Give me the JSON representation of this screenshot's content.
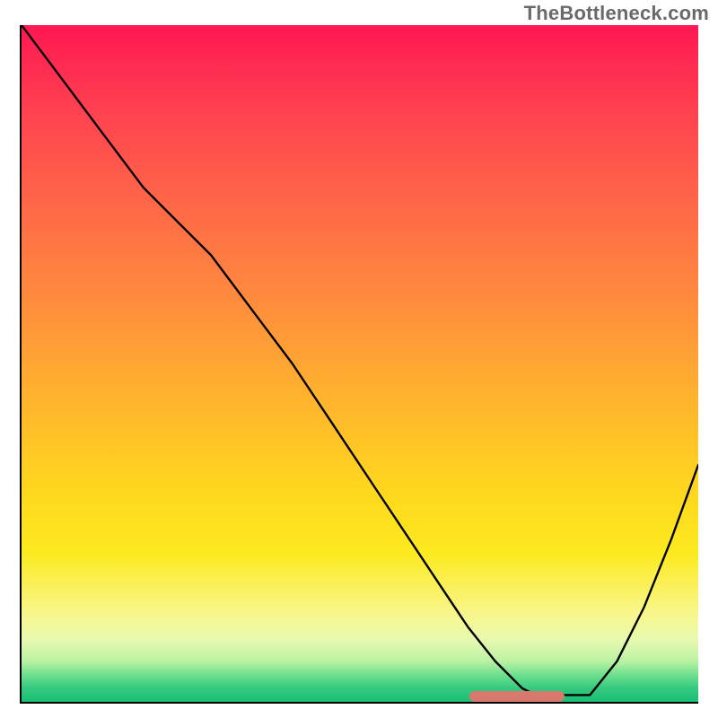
{
  "watermark": "TheBottleneck.com",
  "colors": {
    "gradient_top": "#ff1752",
    "gradient_bottom": "#17bf75",
    "curve_color": "#000000",
    "marker_color": "#d9796e",
    "axis_color": "#000000"
  },
  "chart_data": {
    "type": "line",
    "title": "",
    "xlabel": "",
    "ylabel": "",
    "xlim": [
      0,
      100
    ],
    "ylim": [
      0,
      100
    ],
    "series": [
      {
        "name": "bottleneck-curve",
        "x": [
          0,
          6,
          12,
          18,
          24,
          28,
          34,
          40,
          46,
          52,
          58,
          62,
          66,
          70,
          72,
          74,
          76,
          80,
          84,
          88,
          92,
          96,
          100
        ],
        "y": [
          100,
          92,
          84,
          76,
          70,
          66,
          58,
          50,
          41,
          32,
          23,
          17,
          11,
          6,
          4,
          2,
          1,
          1,
          1,
          6,
          14,
          24,
          35
        ]
      }
    ],
    "marker": {
      "name": "optimal-range",
      "x_start": 66,
      "x_end": 80,
      "y": 1
    },
    "background": "vertical gradient red→orange→yellow→green",
    "legend": null,
    "grid": false
  }
}
